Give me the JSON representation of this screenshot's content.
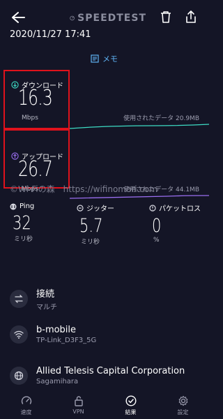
{
  "header": {
    "brand": "SPEEDTEST",
    "icons": {
      "back": "arrow-left-icon",
      "delete": "trash-icon",
      "share": "share-icon"
    }
  },
  "result": {
    "datetime": "2020/11/27 17:41",
    "memo_label": "メモ"
  },
  "download": {
    "label": "ダウンロード",
    "value": "16.3",
    "unit": "Mbps",
    "data_used": "使用されたデータ 20.9MB",
    "color": "#3ddcc4"
  },
  "upload": {
    "label": "アップロード",
    "value": "26.7",
    "unit": "Mbps",
    "data_used": "使用されたデータ 44.1MB",
    "color": "#9a6ef0"
  },
  "watermark": "©Wi-Fiの森　https://wifinomori.com",
  "stats": {
    "ping": {
      "label": "Ping",
      "value": "32",
      "unit": "ミリ秒"
    },
    "jitter": {
      "label": "ジッター",
      "value": "5.7",
      "unit": "ミリ秒"
    },
    "loss": {
      "label": "パケットロス",
      "value": "0",
      "unit": "%"
    }
  },
  "info": {
    "connection": {
      "title": "接続",
      "sub": "マルチ"
    },
    "network": {
      "title": "b-mobile",
      "sub": "TP-Link_D3F3_5G"
    },
    "server": {
      "title": "Allied Telesis Capital Corporation",
      "sub": "Sagamihara"
    }
  },
  "nav": {
    "speed": "速度",
    "vpn": "VPN",
    "results": "結果",
    "settings": "設定"
  },
  "colors": {
    "accent": "#5fb3f5",
    "highlight_box": "#e0121c",
    "background": "#141526"
  }
}
